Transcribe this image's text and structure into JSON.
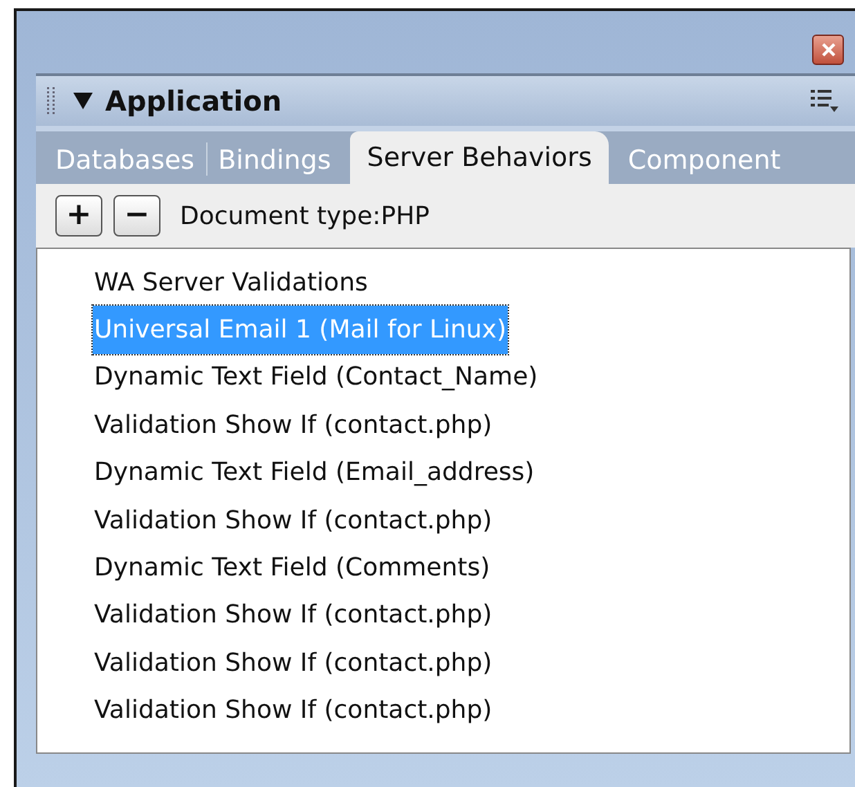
{
  "panel": {
    "title": "Application",
    "expanded": true
  },
  "tabs": [
    {
      "label": "Databases",
      "selected": false
    },
    {
      "label": "Bindings",
      "selected": false
    },
    {
      "label": "Server Behaviors",
      "selected": true
    },
    {
      "label": "Component",
      "selected": false
    }
  ],
  "toolbar": {
    "add": "+",
    "remove": "−",
    "document_type": "Document type:PHP"
  },
  "items": [
    {
      "label": "WA Server Validations",
      "selected": false
    },
    {
      "label": "Universal Email 1 (Mail for Linux)",
      "selected": true
    },
    {
      "label": "Dynamic Text Field (Contact_Name)",
      "selected": false
    },
    {
      "label": "Validation Show If (contact.php)",
      "selected": false
    },
    {
      "label": "Dynamic Text Field (Email_address)",
      "selected": false
    },
    {
      "label": "Validation Show If (contact.php)",
      "selected": false
    },
    {
      "label": "Dynamic Text Field (Comments)",
      "selected": false
    },
    {
      "label": "Validation Show If (contact.php)",
      "selected": false
    },
    {
      "label": "Validation Show If (contact.php)",
      "selected": false
    },
    {
      "label": "Validation Show If (contact.php)",
      "selected": false
    }
  ]
}
